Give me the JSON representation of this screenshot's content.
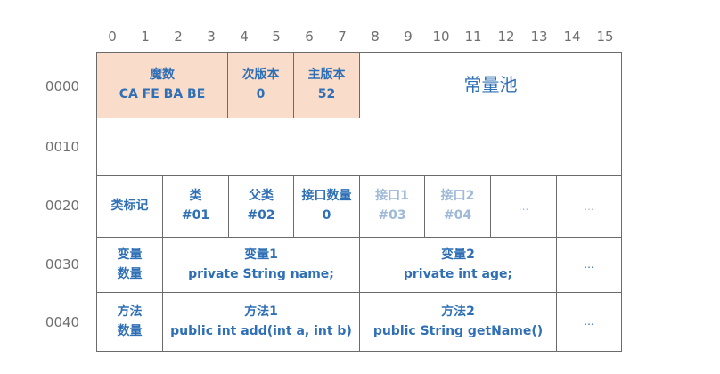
{
  "column_numbers": [
    "0",
    "1",
    "2",
    "3",
    "4",
    "5",
    "6",
    "7",
    "8",
    "9",
    "10",
    "11",
    "12",
    "13",
    "14",
    "15"
  ],
  "row_addresses": [
    "0000",
    "0010",
    "0020",
    "0030",
    "0040"
  ],
  "row0": {
    "magic": {
      "label": "魔数",
      "value": "CA FE BA BE"
    },
    "minor": {
      "label": "次版本",
      "value": "0"
    },
    "major": {
      "label": "主版本",
      "value": "52"
    },
    "pool": "常量池"
  },
  "row2": {
    "access": "类标记",
    "this_class": {
      "label": "类",
      "value": "#01"
    },
    "super_class": {
      "label": "父类",
      "value": "#02"
    },
    "iface_count": {
      "label": "接口数量",
      "value": "0"
    },
    "iface1": {
      "label": "接口1",
      "value": "#03"
    },
    "iface2": {
      "label": "接口2",
      "value": "#04"
    },
    "more1": "...",
    "more2": "..."
  },
  "row3": {
    "count": {
      "line1": "变量",
      "line2": "数量"
    },
    "field1": {
      "label": "变量1",
      "value": "private String name;"
    },
    "field2": {
      "label": "变量2",
      "value": "private int age;"
    },
    "more": "..."
  },
  "row4": {
    "count": {
      "line1": "方法",
      "line2": "数量"
    },
    "method1": {
      "label": "方法1",
      "value": "public int add(int a, int b)"
    },
    "method2": {
      "label": "方法2",
      "value": "public String getName()"
    },
    "more": "..."
  },
  "colors": {
    "text": "#2e6fb5",
    "muted": "#9fb9d8",
    "header_bg": "#f9dcc9",
    "border": "#6b6b6b"
  }
}
